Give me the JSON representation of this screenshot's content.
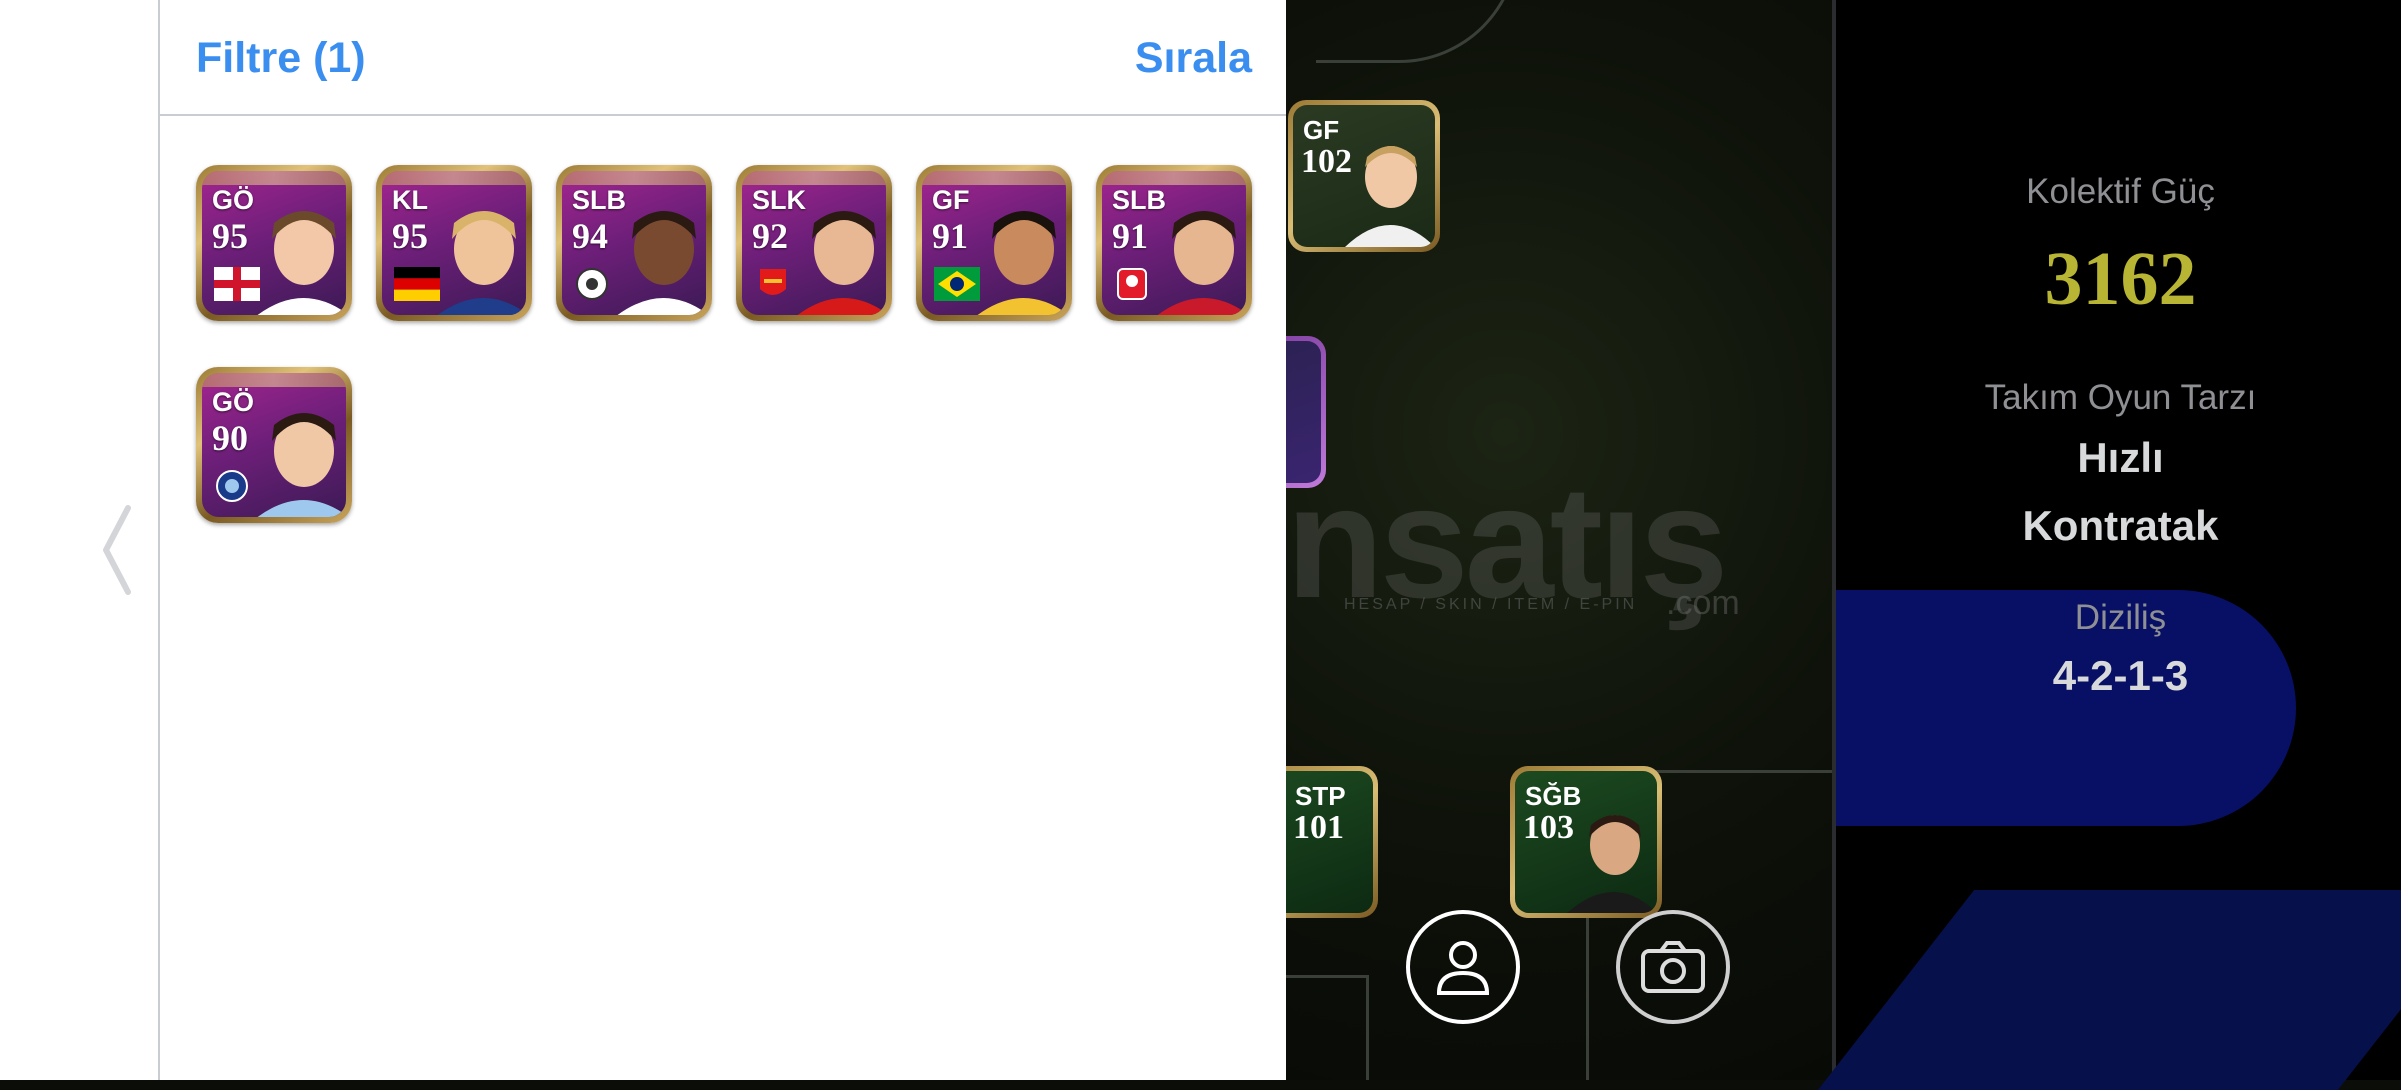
{
  "filter_panel": {
    "title": "Filtre (1)",
    "sort_label": "Sırala",
    "cards": [
      {
        "position": "GÖ",
        "rating": "95",
        "badge": "england-flag",
        "skin": "#f2c8a8",
        "hair": "#6a4a2a",
        "shirt": "#ffffff"
      },
      {
        "position": "KL",
        "rating": "95",
        "badge": "germany-flag",
        "skin": "#f0c49a",
        "hair": "#d9b36a",
        "shirt": "#1f3d8a"
      },
      {
        "position": "SLB",
        "rating": "94",
        "badge": "club-crest-white",
        "skin": "#7a4a30",
        "hair": "#2a1a12",
        "shirt": "#ffffff"
      },
      {
        "position": "SLK",
        "rating": "92",
        "badge": "arsenal-crest",
        "skin": "#e8b894",
        "hair": "#2a1a12",
        "shirt": "#d61a1a"
      },
      {
        "position": "GF",
        "rating": "91",
        "badge": "brazil-flag",
        "skin": "#c98a5e",
        "hair": "#1a120c",
        "shirt": "#f2c230"
      },
      {
        "position": "SLB",
        "rating": "91",
        "badge": "club-crest-red",
        "skin": "#e6b690",
        "hair": "#2a1a12",
        "shirt": "#c81a2a"
      },
      {
        "position": "GÖ",
        "rating": "90",
        "badge": "club-crest-blue",
        "skin": "#f0c8a6",
        "hair": "#2a1a12",
        "shirt": "#9ec8ee"
      }
    ]
  },
  "pitch": {
    "cards": [
      {
        "position": "GF",
        "rating": "102"
      },
      {
        "position": "STP",
        "rating": "101"
      },
      {
        "position": "SĞB",
        "rating": "103"
      }
    ],
    "watermark": "nsatış",
    "watermark_sub": "HESAP / SKIN / ITEM / E-PIN",
    "watermark_domain": ".com",
    "buttons": {
      "profile_icon": "person-icon",
      "camera_icon": "camera-icon"
    }
  },
  "team_info": {
    "power_label": "Kolektif Güç",
    "power_value": "3162",
    "style_label": "Takım Oyun Tarzı",
    "style_value_line1": "Hızlı",
    "style_value_line2": "Kontratak",
    "formation_label": "Diziliş",
    "formation_value": "4-2-1-3"
  },
  "colors": {
    "accent_blue": "#3a8ef0",
    "power_yellow": "#b9b534",
    "card_purple": "#8a2282"
  }
}
